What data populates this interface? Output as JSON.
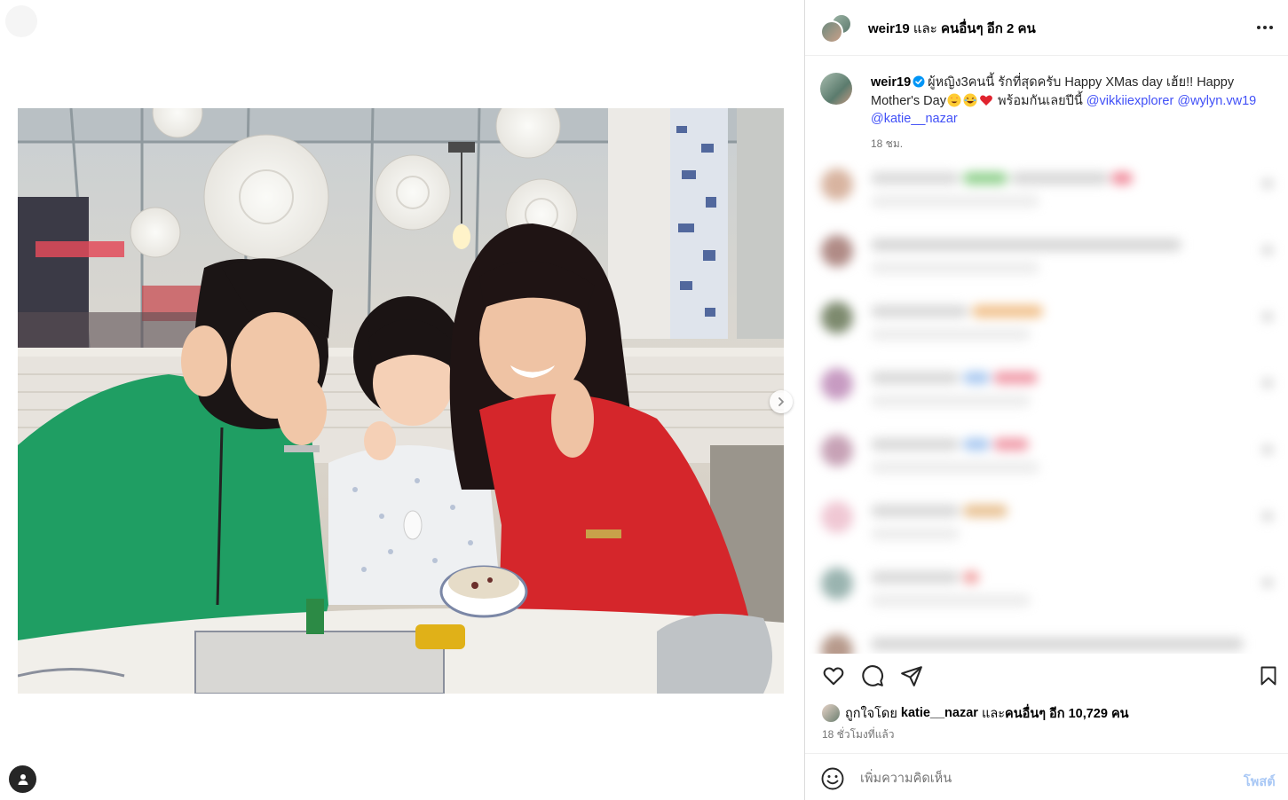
{
  "post": {
    "header": {
      "username": "weir19",
      "and_text": "และ",
      "others_text": "คนอื่นๆ อีก 2 คน"
    },
    "caption": {
      "username": "weir19",
      "text_part1": "ผู้หญิง3คนนี้ รักที่สุดครับ Happy XMas day เฮ้ย!! Happy Mother's Day",
      "text_part2": "พร้อมกันเลยปีนี้",
      "mention1": "@vikkiiexplorer",
      "mention2": "@wylyn.vw19",
      "mention3": "@katie__nazar",
      "time": "18 ชม."
    },
    "likes": {
      "prefix": "ถูกใจโดย",
      "user": "katie__nazar",
      "and_text": "และ",
      "others": "คนอื่นๆ อีก 10,729 คน"
    },
    "post_time": "18 ชั่วโมงที่แล้ว",
    "comment_box": {
      "placeholder": "เพิ่มความคิดเห็น",
      "post_label": "โพสต์"
    }
  },
  "icons": {
    "more": "more-horizontal-icon",
    "like": "heart-icon",
    "comment": "comment-bubble-icon",
    "share": "paper-plane-icon",
    "save": "bookmark-icon",
    "emoji": "smiley-icon",
    "next": "chevron-right-icon",
    "person": "person-icon",
    "verified": "verified-badge-icon"
  },
  "colors": {
    "mention": "#4150f7",
    "meta_gray": "#737373",
    "post_button_disabled": "#a9c8f5",
    "verified": "#0095f6"
  }
}
